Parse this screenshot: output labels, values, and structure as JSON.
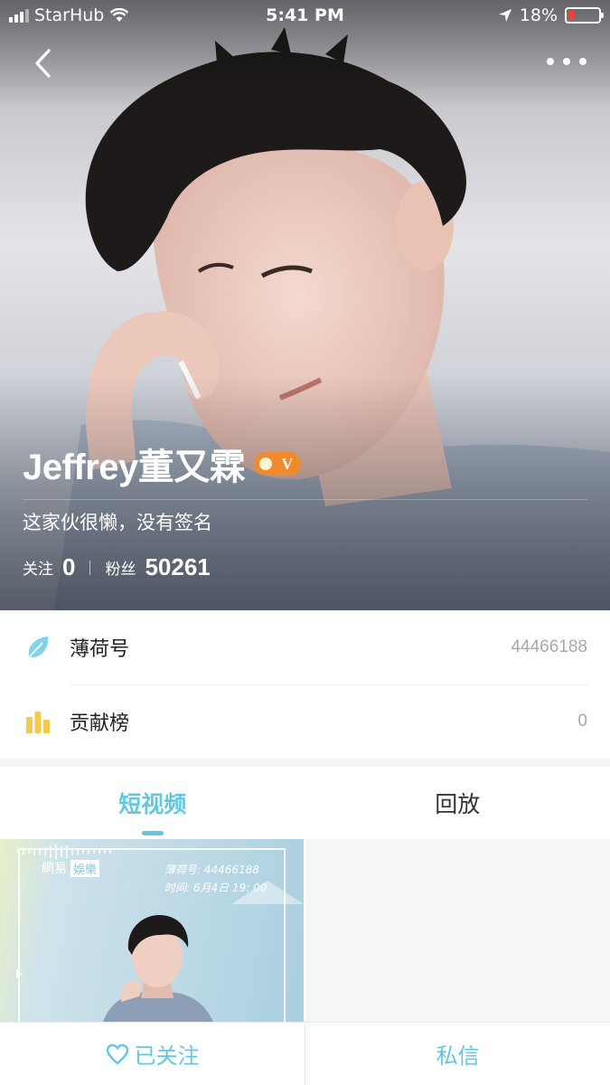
{
  "status_bar": {
    "carrier": "StarHub",
    "time": "5:41 PM",
    "battery_text": "18%",
    "battery_level": 0.18
  },
  "profile": {
    "name": "Jeffrey董又霖",
    "verified_badge": "V",
    "bio": "这家伙很懒，没有签名",
    "following_label": "关注",
    "following_count": "0",
    "fans_label": "粉丝",
    "fans_count": "50261"
  },
  "info": [
    {
      "icon": "leaf-icon",
      "label": "薄荷号",
      "value": "44466188"
    },
    {
      "icon": "bar-chart-icon",
      "label": "贡献榜",
      "value": "0"
    }
  ],
  "tabs": [
    {
      "label": "短视频",
      "active": true
    },
    {
      "label": "回放",
      "active": false
    }
  ],
  "video": {
    "brand_a": "網易",
    "brand_b": "娛樂",
    "id_line": "薄荷号: 44466188",
    "time_line": "时间: 6月4日 19: 00"
  },
  "bottom_bar": {
    "follow_label": "已关注",
    "message_label": "私信"
  },
  "colors": {
    "accent": "#63c7e0",
    "badge": "#f08a2c",
    "battery_low": "#ff3b30",
    "leaf": "#7fd3ec",
    "bars": "#f7c94a"
  }
}
